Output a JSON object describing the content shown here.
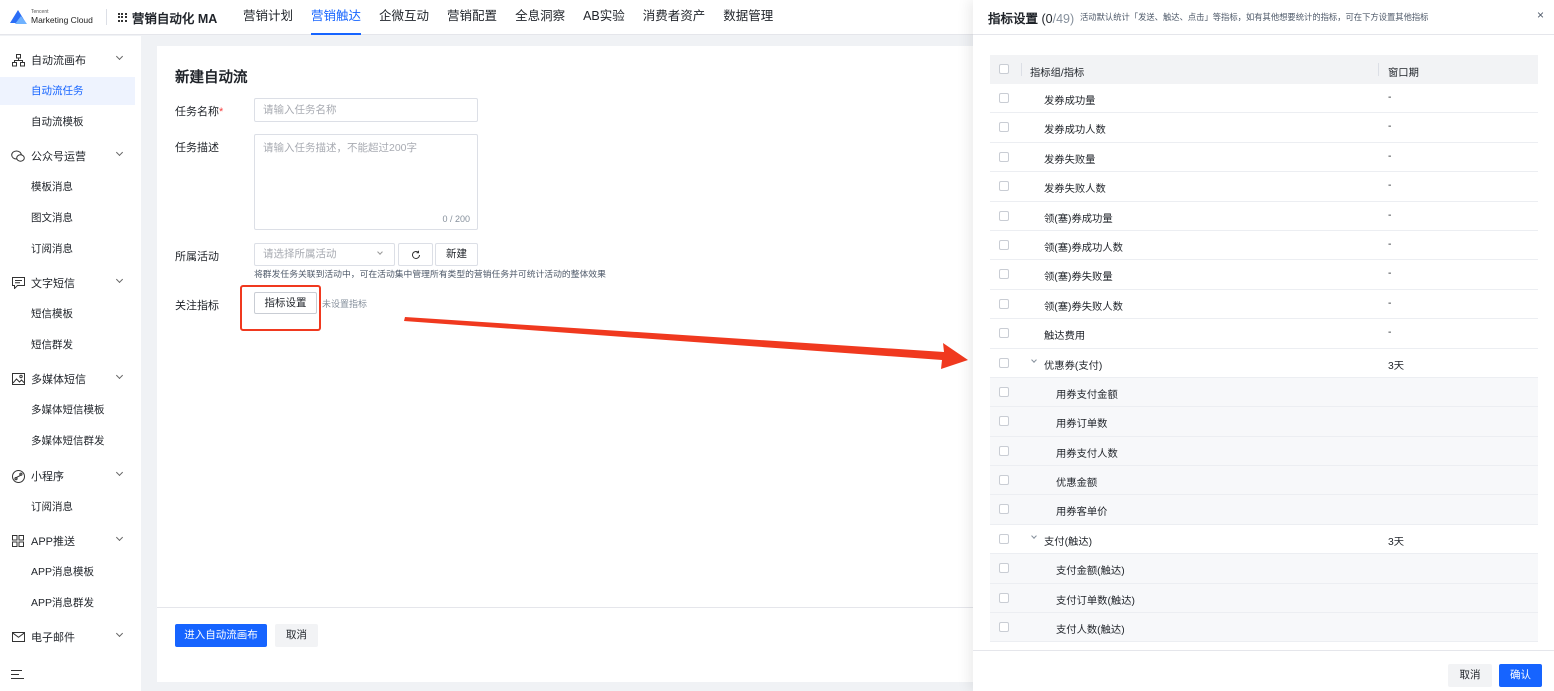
{
  "header": {
    "logo_small": "Tencent",
    "logo_big": "Marketing Cloud",
    "app_name": "营销自动化 MA",
    "nav": [
      {
        "label": "营销计划"
      },
      {
        "label": "营销触达"
      },
      {
        "label": "企微互动"
      },
      {
        "label": "营销配置"
      },
      {
        "label": "全息洞察"
      },
      {
        "label": "AB实验"
      },
      {
        "label": "消费者资产"
      },
      {
        "label": "数据管理"
      }
    ]
  },
  "sidebar": {
    "groups": [
      {
        "label": "自动流画布",
        "icon": "flow-icon"
      },
      {
        "label": "公众号运营",
        "icon": "wechat-icon"
      },
      {
        "label": "文字短信",
        "icon": "sms-icon"
      },
      {
        "label": "多媒体短信",
        "icon": "image-icon"
      },
      {
        "label": "小程序",
        "icon": "miniprogram-icon"
      },
      {
        "label": "APP推送",
        "icon": "apps-icon"
      },
      {
        "label": "电子邮件",
        "icon": "mail-icon"
      }
    ],
    "items": [
      {
        "label": "自动流任务"
      },
      {
        "label": "自动流模板"
      },
      {
        "label": "模板消息"
      },
      {
        "label": "图文消息"
      },
      {
        "label": "订阅消息"
      },
      {
        "label": "短信模板"
      },
      {
        "label": "短信群发"
      },
      {
        "label": "多媒体短信模板"
      },
      {
        "label": "多媒体短信群发"
      },
      {
        "label": "订阅消息"
      },
      {
        "label": "APP消息模板"
      },
      {
        "label": "APP消息群发"
      }
    ]
  },
  "form": {
    "title": "新建自动流",
    "task_name_label": "任务名称",
    "required_mark": "*",
    "task_name_placeholder": "请输入任务名称",
    "task_desc_label": "任务描述",
    "task_desc_placeholder": "请输入任务描述，不能超过200字",
    "task_desc_count": "0 / 200",
    "activity_label": "所属活动",
    "activity_placeholder": "请选择所属活动",
    "new_label": "新建",
    "activity_hint": "将群发任务关联到活动中，可在活动集中管理所有类型的营销任务并可统计活动的整体效果",
    "metric_label": "关注指标",
    "metric_button": "指标设置",
    "metric_none": "未设置指标",
    "primary_button": "进入自动流画布",
    "cancel_button": "取消"
  },
  "drawer": {
    "title": "指标设置",
    "count_open": "(",
    "count_selected": "0",
    "count_total": "/49)",
    "subtitle": "活动默认统计「发送、触达、点击」等指标，如有其他想要统计的指标，可在下方设置其他指标",
    "close": "×",
    "col_name": "指标组/指标",
    "col_window": "窗口期",
    "rows": [
      {
        "name": "发券成功量",
        "window": "-",
        "type": "item"
      },
      {
        "name": "发券成功人数",
        "window": "-",
        "type": "item"
      },
      {
        "name": "发券失败量",
        "window": "-",
        "type": "item"
      },
      {
        "name": "发券失败人数",
        "window": "-",
        "type": "item"
      },
      {
        "name": "领(塞)券成功量",
        "window": "-",
        "type": "item"
      },
      {
        "name": "领(塞)券成功人数",
        "window": "-",
        "type": "item"
      },
      {
        "name": "领(塞)券失败量",
        "window": "-",
        "type": "item"
      },
      {
        "name": "领(塞)券失败人数",
        "window": "-",
        "type": "item"
      },
      {
        "name": "触达费用",
        "window": "-",
        "type": "item"
      },
      {
        "name": "优惠券(支付)",
        "window": "3天",
        "type": "group"
      },
      {
        "name": "用券支付金额",
        "window": "",
        "type": "child"
      },
      {
        "name": "用券订单数",
        "window": "",
        "type": "child"
      },
      {
        "name": "用券支付人数",
        "window": "",
        "type": "child"
      },
      {
        "name": "优惠金额",
        "window": "",
        "type": "child"
      },
      {
        "name": "用券客单价",
        "window": "",
        "type": "child"
      },
      {
        "name": "支付(触达)",
        "window": "3天",
        "type": "group"
      },
      {
        "name": "支付金额(触达)",
        "window": "",
        "type": "child"
      },
      {
        "name": "支付订单数(触达)",
        "window": "",
        "type": "child"
      },
      {
        "name": "支付人数(触达)",
        "window": "",
        "type": "child"
      }
    ],
    "cancel_button": "取消",
    "ok_button": "确认"
  },
  "colors": {
    "accent": "#1664ff",
    "annotation": "#f0391f"
  }
}
